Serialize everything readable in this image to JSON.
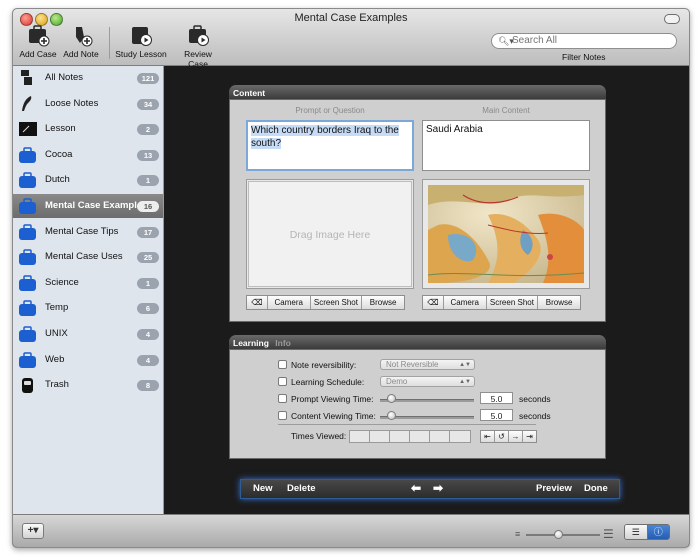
{
  "window": {
    "title": "Mental Case Examples"
  },
  "toolbar": {
    "buttons": [
      {
        "label": "Add Case",
        "icon": "add-case-icon"
      },
      {
        "label": "Add Note",
        "icon": "add-note-icon"
      },
      {
        "label": "Study Lesson",
        "icon": "study-lesson-icon"
      },
      {
        "label": "Review Case",
        "icon": "review-case-icon"
      }
    ],
    "search_placeholder": "Search All",
    "filter_label": "Filter Notes"
  },
  "sidebar": {
    "items": [
      {
        "label": "All Notes",
        "count": "121",
        "icon": "all-notes-icon"
      },
      {
        "label": "Loose Notes",
        "count": "34",
        "icon": "quill-icon"
      },
      {
        "label": "Lesson",
        "count": "2",
        "icon": "lesson-board-icon"
      },
      {
        "label": "Cocoa",
        "count": "13",
        "icon": "case-icon"
      },
      {
        "label": "Dutch",
        "count": "1",
        "icon": "case-icon"
      },
      {
        "label": "Mental Case Examples",
        "count": "16",
        "icon": "case-icon",
        "selected": true
      },
      {
        "label": "Mental Case Tips",
        "count": "17",
        "icon": "case-icon"
      },
      {
        "label": "Mental Case Uses",
        "count": "25",
        "icon": "case-icon"
      },
      {
        "label": "Science",
        "count": "1",
        "icon": "case-icon"
      },
      {
        "label": "Temp",
        "count": "6",
        "icon": "case-icon"
      },
      {
        "label": "UNIX",
        "count": "4",
        "icon": "case-icon"
      },
      {
        "label": "Web",
        "count": "4",
        "icon": "case-icon"
      },
      {
        "label": "Trash",
        "count": "8",
        "icon": "trash-icon"
      }
    ]
  },
  "content": {
    "title": "Content",
    "prompt_header": "Prompt or Question",
    "main_header": "Main Content",
    "prompt_text": "Which country borders Iraq to the south?",
    "main_text": "Saudi Arabia",
    "drag_placeholder": "Drag Image Here",
    "image_buttons": [
      "Camera",
      "Screen Shot",
      "Browse"
    ]
  },
  "learning": {
    "tab_learning": "Learning",
    "tab_info": "Info",
    "note_reversibility_label": "Note reversibility:",
    "note_reversibility_value": "Not Reversible",
    "learning_schedule_label": "Learning Schedule:",
    "learning_schedule_value": "Demo",
    "prompt_viewing_label": "Prompt Viewing Time:",
    "prompt_viewing_value": "5.0",
    "content_viewing_label": "Content Viewing Time:",
    "content_viewing_value": "5.0",
    "seconds": "seconds",
    "times_viewed_label": "Times Viewed:"
  },
  "bottom_bar": {
    "new": "New",
    "delete": "Delete",
    "preview": "Preview",
    "done": "Done"
  },
  "status_bar": {
    "add_label": "+▾"
  },
  "colors": {
    "selection": "#7ca7d9",
    "sidebar_bg": "#dfe5ed",
    "main_bg": "#1b1b1b",
    "glow": "#3a6fd0"
  }
}
